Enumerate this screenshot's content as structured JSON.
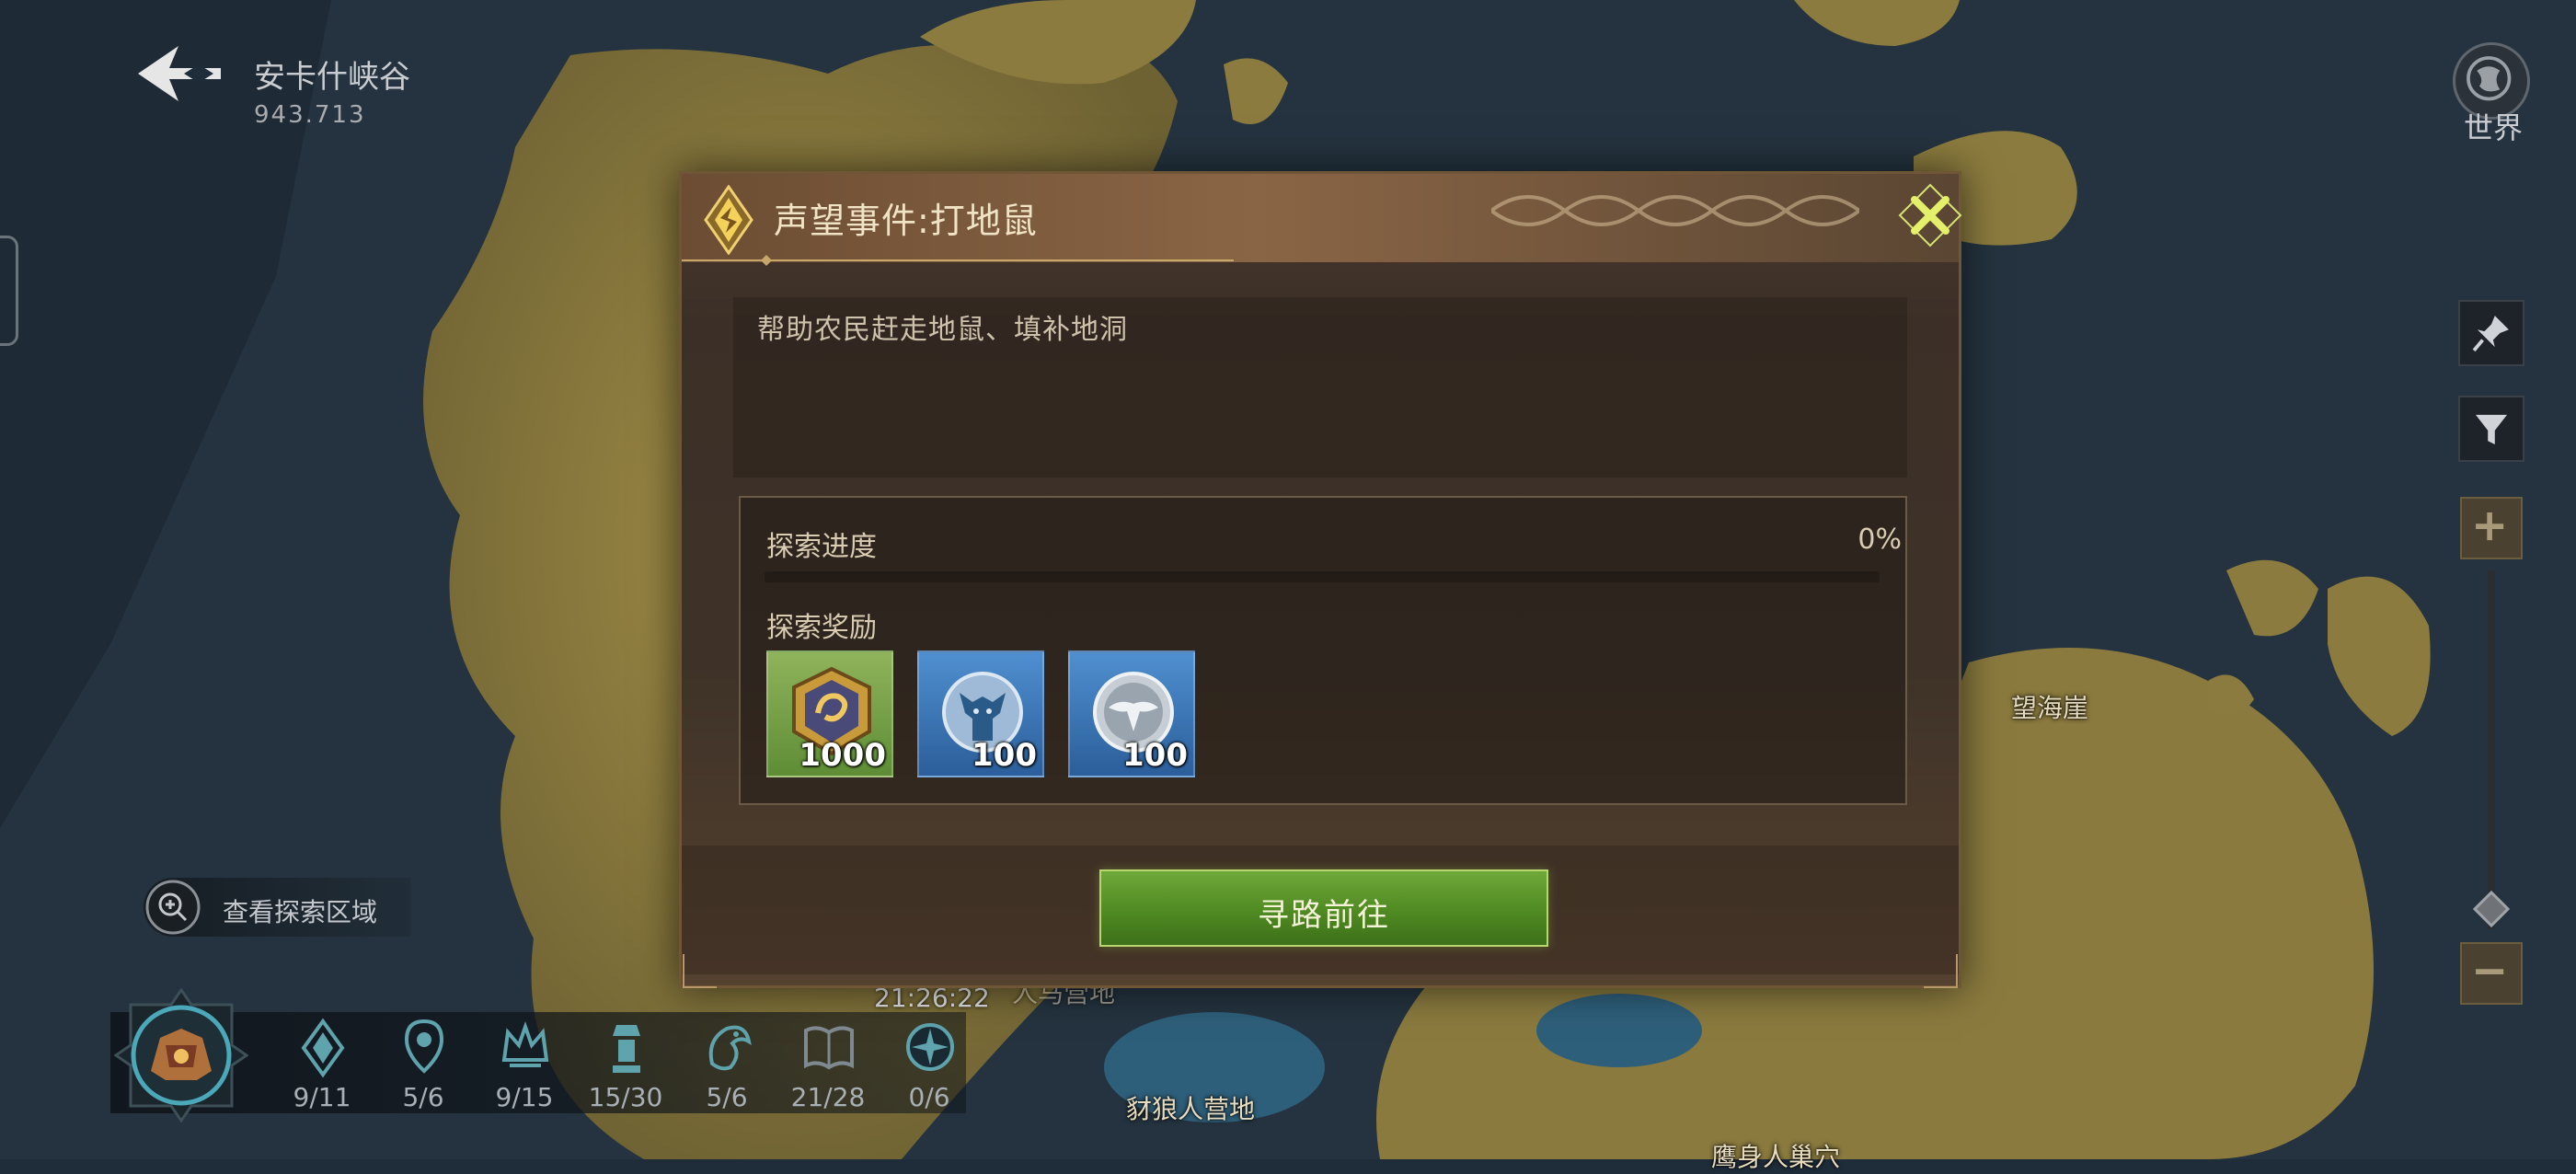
{
  "header": {
    "region_name": "安卡什峡谷",
    "coords": "943.713"
  },
  "world_button": {
    "label": "世界",
    "icon": "globe-icon"
  },
  "side_controls": {
    "pin_icon": "pin-icon",
    "filter_icon": "filter-icon",
    "zoom_in": "+",
    "zoom_out": "−"
  },
  "map": {
    "labels": [
      "望海崖",
      "豺狼人营地",
      "鹰身人巢穴",
      "人马营地"
    ]
  },
  "explore_area": {
    "label": "查看探索区域",
    "icon": "zoom-search-icon"
  },
  "clock": "21:26:22",
  "stats": [
    {
      "icon": "crystal-icon",
      "value": "9/11"
    },
    {
      "icon": "location-pin-icon",
      "value": "5/6"
    },
    {
      "icon": "crown-icon",
      "value": "9/15"
    },
    {
      "icon": "totem-icon",
      "value": "15/30"
    },
    {
      "icon": "dragon-icon",
      "value": "5/6"
    },
    {
      "icon": "book-icon",
      "value": "21/28"
    },
    {
      "icon": "compass-icon",
      "value": "0/6"
    }
  ],
  "dialog": {
    "title": "声望事件:打地鼠",
    "description": "帮助农民赶走地鼠、填补地洞",
    "progress_label": "探索进度",
    "progress_value": "0%",
    "progress_fraction": 0,
    "reward_label": "探索奖励",
    "rewards": [
      {
        "icon": "reputation-coin-icon",
        "qty": "1000",
        "color": "#7aa64a"
      },
      {
        "icon": "tauren-totem-icon",
        "qty": "100",
        "color": "#3d78b8"
      },
      {
        "icon": "silver-emblem-icon",
        "qty": "100",
        "color": "#3d78b8"
      }
    ],
    "go_button": "寻路前往",
    "accent": "#c8e050"
  }
}
